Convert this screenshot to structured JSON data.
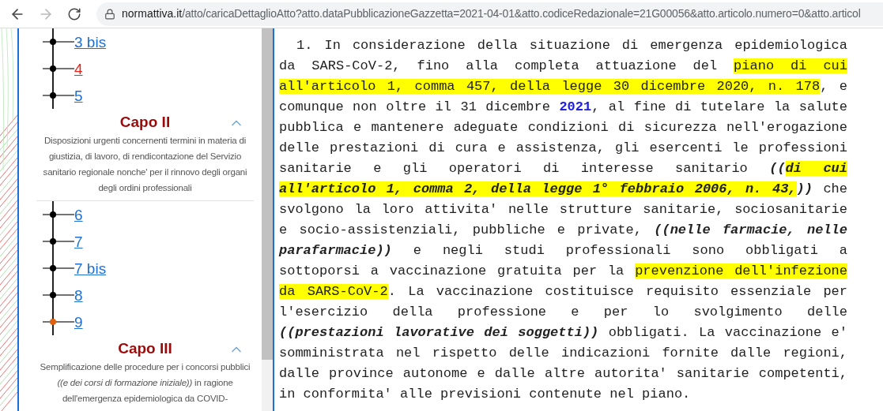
{
  "browser": {
    "back_disabled": false,
    "forward_disabled": true,
    "url_domain": "normattiva.it",
    "url_path": "/atto/caricaDettaglioAtto?atto.dataPubblicazioneGazzetta=2021-04-01&atto.codiceRedazionale=21G00056&atto.articolo.numero=0&atto.articol"
  },
  "sidebar": {
    "sections": [
      {
        "kind": "articles",
        "items": [
          {
            "label": "3 bis",
            "visited": false,
            "current": false
          },
          {
            "label": "4",
            "visited": true,
            "current": false
          },
          {
            "label": "5",
            "visited": false,
            "current": false
          }
        ]
      },
      {
        "kind": "chapter",
        "title": "Capo II",
        "expanded": true,
        "description": "Disposizioni urgenti concernenti termini in materia di giustizia, di lavoro, di rendicontazione del Servizio sanitario regionale nonche' per il rinnovo degli organi degli ordini professionali"
      },
      {
        "kind": "articles",
        "items": [
          {
            "label": "6",
            "visited": false,
            "current": false
          },
          {
            "label": "7",
            "visited": false,
            "current": false
          },
          {
            "label": "7 bis",
            "visited": false,
            "current": false
          },
          {
            "label": "8",
            "visited": false,
            "current": false
          },
          {
            "label": "9",
            "visited": false,
            "current": true
          }
        ]
      },
      {
        "kind": "chapter",
        "title": "Capo III",
        "expanded": true,
        "description": "Semplificazione delle procedure per i concorsi pubblici *((e dei corsi di formazione iniziale))* in ragione dell'emergenza epidemiologica da COVID-"
      }
    ]
  },
  "article": {
    "lines": [
      {
        "indent": true,
        "segments": [
          {
            "kind": "plain",
            "text": "1. In considerazione della situazione di emergenza epidemiologica"
          }
        ]
      },
      {
        "segments": [
          {
            "kind": "plain",
            "text": "da SARS-CoV-2, fino alla completa attuazione del "
          },
          {
            "kind": "highlight",
            "text": "piano di cui"
          }
        ]
      },
      {
        "segments": [
          {
            "kind": "highlight",
            "text": "all'articolo 1, comma 457, della legge 30 dicembre 2020, n. 178"
          },
          {
            "kind": "plain",
            "text": ", e"
          }
        ]
      },
      {
        "segments": [
          {
            "kind": "plain",
            "text": "comunque non oltre il 31 dicembre "
          },
          {
            "kind": "year",
            "text": "2021"
          },
          {
            "kind": "plain",
            "text": ", al fine di tutelare la salute"
          }
        ]
      },
      {
        "segments": [
          {
            "kind": "plain",
            "text": "pubblica e mantenere adeguate condizioni di sicurezza nell'erogazione"
          }
        ]
      },
      {
        "segments": [
          {
            "kind": "plain",
            "text": "delle prestazioni di cura e assistenza, gli esercenti le professioni"
          }
        ]
      },
      {
        "segments": [
          {
            "kind": "plain",
            "text": "sanitarie e gli operatori di interesse sanitario "
          },
          {
            "kind": "amendment",
            "text": "(("
          },
          {
            "kind": "amendment-highlight",
            "text": "di cui"
          }
        ]
      },
      {
        "segments": [
          {
            "kind": "amendment-highlight",
            "text": "all'articolo 1, comma 2, della legge 1° febbraio 2006, n. 43,"
          },
          {
            "kind": "amendment",
            "text": "))"
          },
          {
            "kind": "plain",
            "text": " che"
          }
        ]
      },
      {
        "segments": [
          {
            "kind": "plain",
            "text": "svolgono la loro attivita' nelle strutture sanitarie, sociosanitarie"
          }
        ]
      },
      {
        "segments": [
          {
            "kind": "plain",
            "text": "e socio-assistenziali, pubbliche e private, "
          },
          {
            "kind": "amendment",
            "text": "((nelle farmacie, nelle"
          }
        ]
      },
      {
        "segments": [
          {
            "kind": "amendment",
            "text": "parafarmacie))"
          },
          {
            "kind": "plain",
            "text": " e negli studi professionali sono obbligati a"
          }
        ]
      },
      {
        "segments": [
          {
            "kind": "plain",
            "text": "sottoporsi a vaccinazione gratuita per la "
          },
          {
            "kind": "highlight",
            "text": "prevenzione dell'infezione"
          }
        ]
      },
      {
        "segments": [
          {
            "kind": "highlight",
            "text": "da SARS-CoV-2"
          },
          {
            "kind": "plain",
            "text": ". La vaccinazione costituisce requisito essenziale per"
          }
        ]
      },
      {
        "segments": [
          {
            "kind": "plain",
            "text": "l'esercizio della professione e per lo svolgimento delle"
          }
        ]
      },
      {
        "segments": [
          {
            "kind": "amendment",
            "text": "((prestazioni lavorative dei soggetti))"
          },
          {
            "kind": "plain",
            "text": " obbligati. La vaccinazione e'"
          }
        ]
      },
      {
        "segments": [
          {
            "kind": "plain",
            "text": "somministrata nel rispetto delle indicazioni fornite dalle regioni,"
          }
        ]
      },
      {
        "segments": [
          {
            "kind": "plain",
            "text": "dalle province autonome e dalle altre autorita' sanitarie competenti,"
          }
        ]
      },
      {
        "segments": [
          {
            "kind": "plain",
            "text": "in conformita' alle previsioni contenute nel piano."
          }
        ]
      }
    ]
  }
}
